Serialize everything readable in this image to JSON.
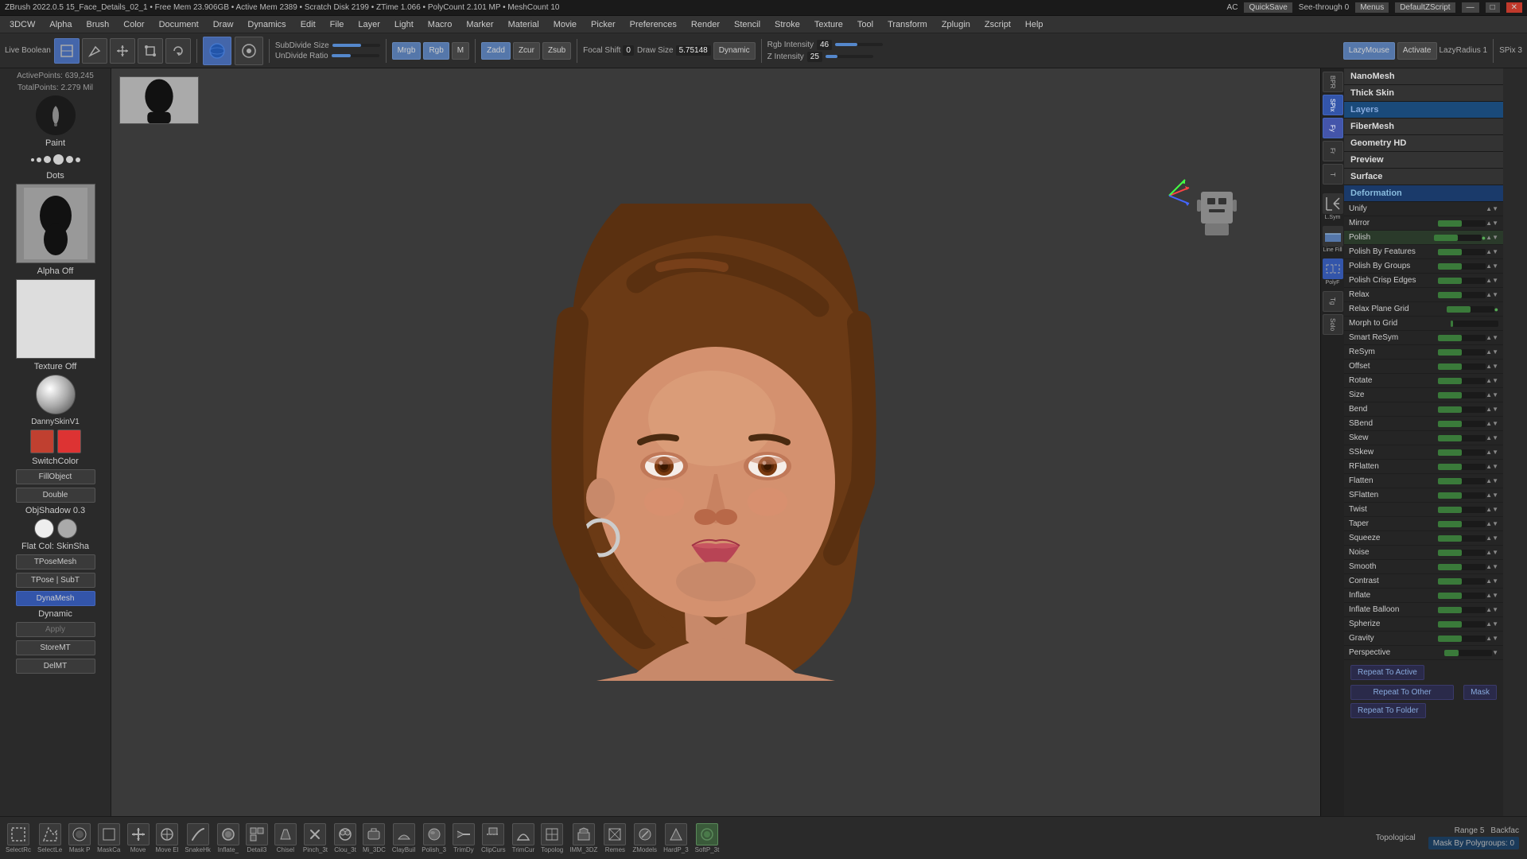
{
  "titleBar": {
    "text": "ZBrush 2022.0.5  15_Face_Details_02_1  • Free Mem 23.906GB • Active Mem 2389 • Scratch Disk 2199 • ZTime 1.066 • PolyCount 2.101 MP • MeshCount 10",
    "quickSave": "QuickSave",
    "acLabel": "AC",
    "menuLabel": "Menus",
    "scriptLabel": "DefaultZScript"
  },
  "menuBar": {
    "items": [
      "3DCW",
      "Alpha",
      "Brush",
      "Color",
      "Document",
      "Draw",
      "Dynamics",
      "Edit",
      "File",
      "Layer",
      "Light",
      "Macro",
      "Marker",
      "Material",
      "Movie",
      "Picker",
      "Preferences",
      "Render",
      "Stencil",
      "Stroke",
      "Texture",
      "Tool",
      "Transform",
      "Zplugin",
      "Zscript",
      "Help"
    ]
  },
  "toolbar": {
    "liveBoolean": "Live Boolean",
    "editBtn": "Edit",
    "drawBtn": "Draw",
    "moveBtn": "Move",
    "scaleBtn": "Scale",
    "rotateBtn": "Rotate",
    "subdivideSize": "SubDivide Size",
    "unDivideRatio": "UnDivide Ratio",
    "mrgb": "Mrgb",
    "rgb": "Rgb",
    "mValue": "M",
    "zadd": "Zadd",
    "zcur": "Zcur",
    "zsub": "Zsub",
    "focalShift": "Focal Shift",
    "focalShiftValue": "0",
    "drawSize": "Draw Size",
    "drawSizeValue": "5.75148",
    "dynamic": "Dynamic",
    "lazyMouse": "LazyMouse",
    "lazyRadius": "LazyRadius 1",
    "activate": "Activate",
    "spix": "SPix 3",
    "rgbIntensity": "Rgb Intensity",
    "rgbIntensityValue": "46",
    "zIntensity": "Z Intensity",
    "zIntensityValue": "25"
  },
  "leftSidebar": {
    "brushLabel": "Paint",
    "dotsLabel": "Dots",
    "alphaLabel": "Alpha Off",
    "textureLabel": "Texture Off",
    "materialLabel": "DannySkinV1",
    "switchColor": "SwitchColor",
    "fillObject": "FillObject",
    "doubleLabel": "Double",
    "objShadow": "ObjShadow 0.3",
    "flatColLabel": "Flat Col: SkinSha",
    "tposeMesh": "TPoseMesh",
    "tposeSubT": "TPose | SubT",
    "dynaMesh": "DynaMesh",
    "dynamic": "Dynamic",
    "apply": "Apply",
    "storeMT": "StoreMT",
    "delMT": "DelMT"
  },
  "rightPanel": {
    "sections": {
      "nanomesh": "NanoMesh",
      "thickSkin": "Thick Skin",
      "layers": "Layers",
      "fibermesh": "FiberMesh",
      "geometryHD": "Geometry HD",
      "preview": "Preview",
      "surface": "Surface",
      "deformation": "Deformation"
    },
    "deformItems": [
      {
        "label": "Unify",
        "slider": 0
      },
      {
        "label": "Mirror",
        "slider": 50
      },
      {
        "label": "Polish",
        "slider": 50
      },
      {
        "label": "Polish By Features",
        "slider": 50
      },
      {
        "label": "Polish By Groups",
        "slider": 50
      },
      {
        "label": "Polish Crisp Edges",
        "slider": 50
      },
      {
        "label": "Relax",
        "slider": 50
      },
      {
        "label": "Relax Plane Grid",
        "slider": 50
      },
      {
        "label": "Morph to Grid",
        "slider": 0
      },
      {
        "label": "Smart ReSym",
        "slider": 50
      },
      {
        "label": "ReSym",
        "slider": 50
      },
      {
        "label": "Offset",
        "slider": 50
      },
      {
        "label": "Rotate",
        "slider": 50
      },
      {
        "label": "Size",
        "slider": 50
      },
      {
        "label": "Bend",
        "slider": 50
      },
      {
        "label": "SBend",
        "slider": 50
      },
      {
        "label": "Skew",
        "slider": 50
      },
      {
        "label": "SSkew",
        "slider": 50
      },
      {
        "label": "RFlatten",
        "slider": 50
      },
      {
        "label": "Flatten",
        "slider": 50
      },
      {
        "label": "SFlatten",
        "slider": 50
      },
      {
        "label": "Twist",
        "slider": 50
      },
      {
        "label": "Taper",
        "slider": 50
      },
      {
        "label": "Squeeze",
        "slider": 50
      },
      {
        "label": "Noise",
        "slider": 50
      },
      {
        "label": "Smooth",
        "slider": 50
      },
      {
        "label": "Contrast",
        "slider": 50
      },
      {
        "label": "Inflate",
        "slider": 50
      },
      {
        "label": "Inflate Balloon",
        "slider": 50
      },
      {
        "label": "Spherize",
        "slider": 50
      },
      {
        "label": "Gravity",
        "slider": 50
      },
      {
        "label": "Perspective",
        "slider": 30
      }
    ],
    "bottomItems": {
      "repeatToActive": "Repeat To Active",
      "repeatToOther": "Repeat To Other",
      "mask": "Mask",
      "repeatToFolder": "Repeat To Folder"
    }
  },
  "viewport": {
    "activePoints": "ActivePoints: 639,245",
    "totalPoints": "TotalPoints: 2.279 Mil"
  },
  "bottomBar": {
    "tools": [
      "SelectRc",
      "SelectLe",
      "Mask P",
      "MaskCa",
      "Move",
      "Move El",
      "SnakeHk",
      "Inflate_",
      "Detail3",
      "Chisel",
      "Pinch_3t",
      "Clou_3t",
      "Mi_3DC",
      "ClayBuil",
      "Polish_3",
      "TrimDy",
      "ClipCurs",
      "TrimCur",
      "Topolog",
      "IMM_3DZ",
      "Remes",
      "ZModels",
      "HardP_3",
      "SoftP_3t"
    ],
    "topological": "Topological",
    "rangeLabel": "Range 5",
    "backface": "Backfac",
    "maskByPolygroups": "Mask By Polygroups: 0"
  },
  "farRightIcons": {
    "items": [
      "BPR",
      "SPix",
      "Ferry",
      "Frame",
      "Tangy",
      "Solo"
    ]
  },
  "axisColors": {
    "x": "#ff4444",
    "y": "#44ff44",
    "z": "#4444ff"
  }
}
